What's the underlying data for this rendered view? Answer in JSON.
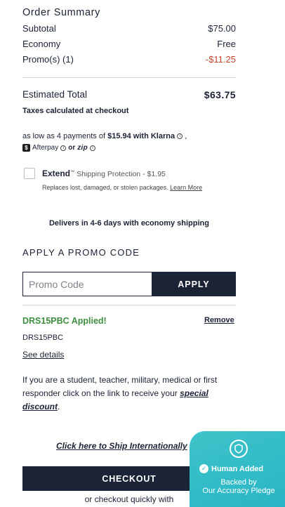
{
  "summary": {
    "title": "Order Summary",
    "rows": [
      {
        "label": "Subtotal",
        "value": "$75.00"
      },
      {
        "label": "Economy",
        "value": "Free"
      },
      {
        "label": "Promo(s) (1)",
        "value": "-$11.25"
      }
    ],
    "estimated_label": "Estimated Total",
    "estimated_value": "$63.75",
    "taxes_note": "Taxes calculated at checkout"
  },
  "financing": {
    "prefix": "as low as 4 payments of",
    "amount": "$15.94",
    "with": "with",
    "klarna": "Klarna",
    "afterpay": "Afterpay",
    "or": "or",
    "zip": "zip",
    "ap_glyph": "$",
    "info_glyph": "i"
  },
  "extend": {
    "brand": "Extend",
    "tm": "™",
    "label": "Shipping Protection",
    "price": "- $1.95",
    "note": "Replaces lost, damaged, or stolen packages.",
    "learn_more": "Learn More"
  },
  "delivery": "Delivers in 4-6 days with economy shipping",
  "promo": {
    "title": "APPLY A PROMO CODE",
    "placeholder": "Promo Code",
    "apply_label": "APPLY",
    "applied_text": "DRS15PBC Applied!",
    "remove_label": "Remove",
    "code": "DRS15PBC",
    "see_details": "See details"
  },
  "discount": {
    "text": "If you are a student, teacher, military, medical or first responder click on the link to receive your",
    "link": "special discount",
    "end": "."
  },
  "ship_intl": "Click here to Ship Internationally",
  "checkout": {
    "label": "CHECKOUT",
    "quickly": "or checkout quickly with"
  },
  "badge": {
    "human_added": "Human Added",
    "backed_by": "Backed by",
    "pledge": "Our Accuracy Pledge",
    "check_glyph": "✓"
  },
  "colors": {
    "navy": "#1b2336",
    "promo_red": "#c1452b",
    "applied_green": "#3e8e41",
    "badge_teal": "#27b3c5"
  }
}
